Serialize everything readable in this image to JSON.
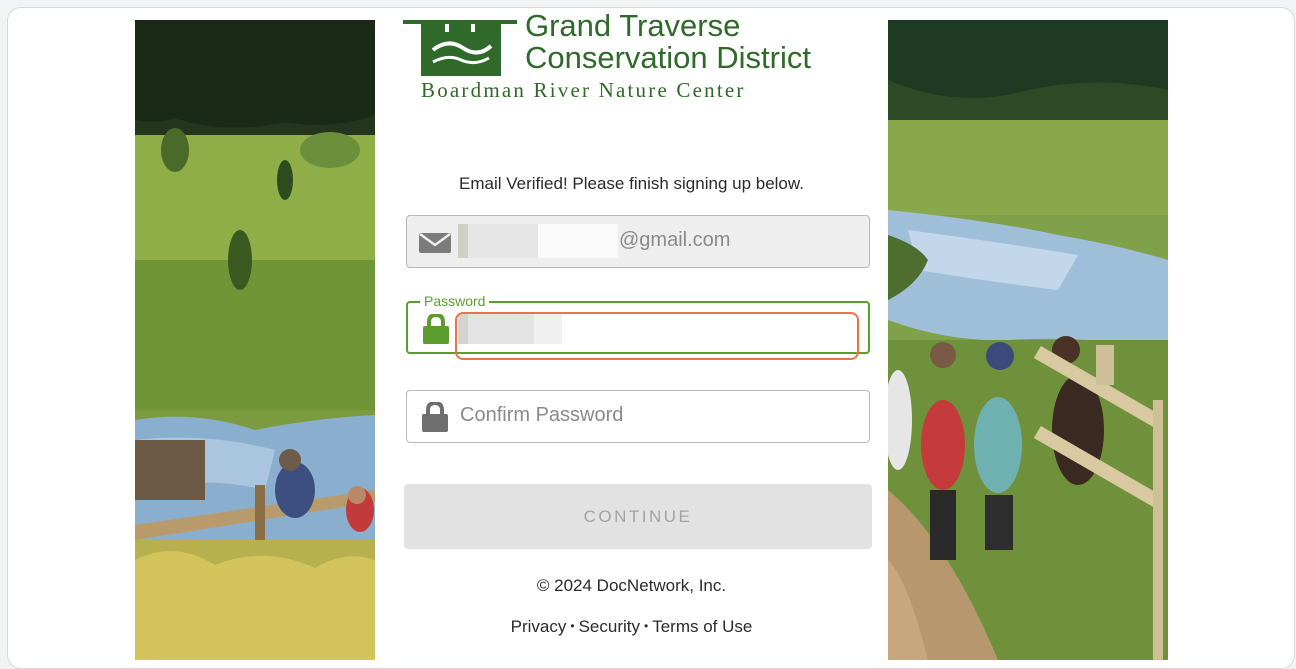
{
  "logo": {
    "line1": "Grand Traverse",
    "line2": "Conservation District",
    "line3": "Boardman River Nature Center"
  },
  "form": {
    "verified_message": "Email Verified! Please finish signing up below.",
    "email": {
      "value_suffix": "@gmail.com",
      "icon": "envelope-icon"
    },
    "password": {
      "legend": "Password",
      "icon": "lock-icon",
      "focused": true
    },
    "confirm_password": {
      "placeholder": "Confirm Password",
      "icon": "lock-icon"
    },
    "continue_label": "CONTINUE"
  },
  "footer": {
    "copyright": "© 2024 DocNetwork, Inc.",
    "links": [
      "Privacy",
      "Security",
      "Terms of Use"
    ]
  },
  "colors": {
    "brand_green": "#2f6a2a",
    "focus_green": "#5c9d2e",
    "highlight_orange": "#e8744a",
    "disabled_button": "#e2e2e2"
  }
}
